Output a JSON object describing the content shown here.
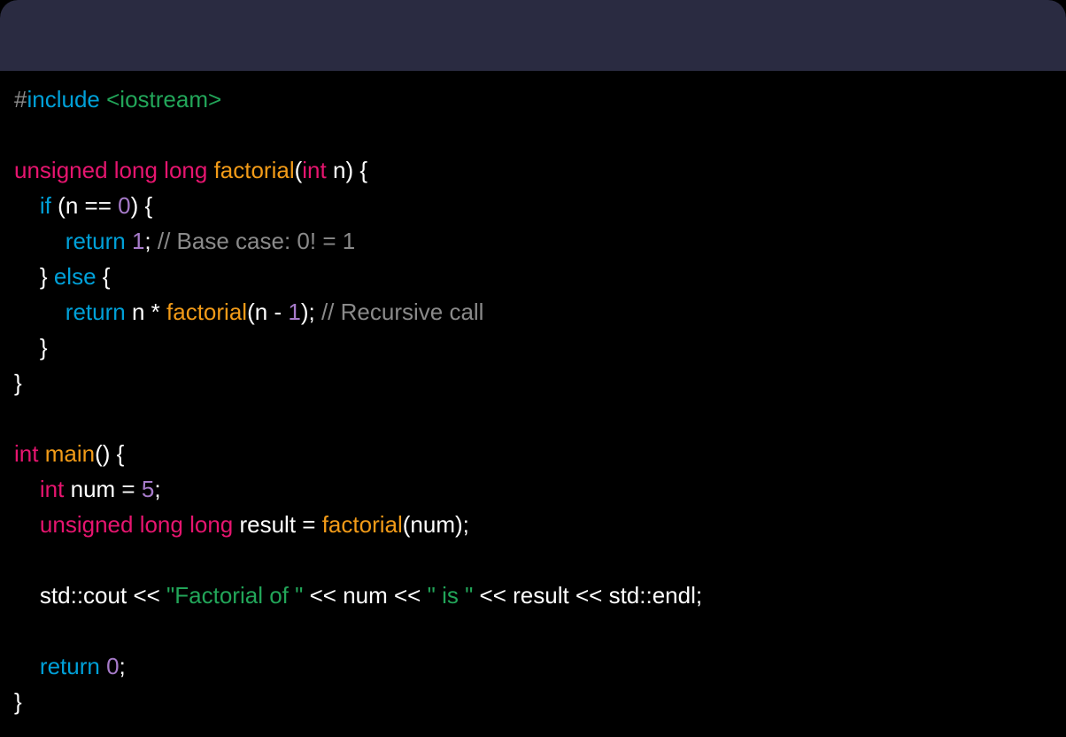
{
  "colors": {
    "background": "#000000",
    "titlebar": "#2a2b41",
    "preproc": "#8a8a8a",
    "include_kw": "#00a0d8",
    "header": "#22a559",
    "type_kw": "#e6156f",
    "func_name": "#f29b18",
    "flow_kw": "#00a0d8",
    "number": "#a77bca",
    "comment": "#8a8a8a",
    "string": "#22a559",
    "default": "#ffffff"
  },
  "tokens": {
    "hash": "#",
    "include": "include",
    "sp": " ",
    "iohdr": "<iostream>",
    "unsigned": "unsigned",
    "long": "long",
    "factorial": "factorial",
    "lparen": "(",
    "int": "int",
    "n": "n",
    "rparen": ")",
    "lbrace": "{",
    "rbrace": "}",
    "if": "if",
    "eqeq": "==",
    "zero": "0",
    "return": "return",
    "one": "1",
    "semi": ";",
    "comment_base": "// Base case: 0! = 1",
    "else": "else",
    "star": "*",
    "minus": "-",
    "comment_rec": "// Recursive call",
    "main": "main",
    "num": "num",
    "eq": "=",
    "five": "5",
    "result": "result",
    "std": "std",
    "coloncolon": "::",
    "cout": "cout",
    "ltlt": "<<",
    "str_fact_of": "\"Factorial of \"",
    "str_is": "\" is \"",
    "endl": "endl"
  },
  "indent": {
    "i1": "    ",
    "i2": "        "
  }
}
